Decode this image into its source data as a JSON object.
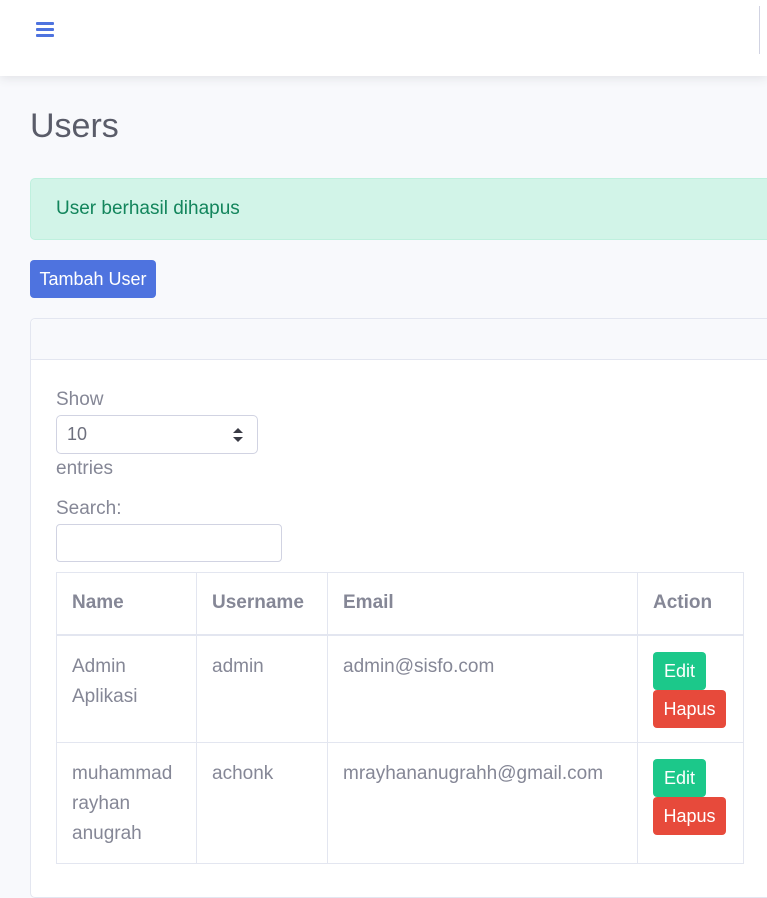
{
  "topbar": {
    "menu_icon": "bars-icon"
  },
  "page": {
    "title": "Users"
  },
  "alert": {
    "message": "User berhasil dihapus"
  },
  "toolbar": {
    "add_label": "Tambah User"
  },
  "datatable": {
    "show_label": "Show",
    "entries_value": "10",
    "entries_label": "entries",
    "search_label": "Search:",
    "search_value": ""
  },
  "table": {
    "headers": [
      "Name",
      "Username",
      "Email",
      "Action"
    ],
    "rows": [
      {
        "name": "Admin Aplikasi",
        "username": "admin",
        "email": "admin@sisfo.com",
        "edit_label": "Edit",
        "delete_label": "Hapus"
      },
      {
        "name": "muhammad rayhan anugrah",
        "username": "achonk",
        "email": "mrayhananugrahh@gmail.com",
        "edit_label": "Edit",
        "delete_label": "Hapus"
      }
    ]
  },
  "colors": {
    "primary": "#4e73df",
    "success": "#1cc88a",
    "danger": "#e74a3b",
    "alert_bg": "#d2f4e8",
    "alert_text": "#13855c"
  }
}
